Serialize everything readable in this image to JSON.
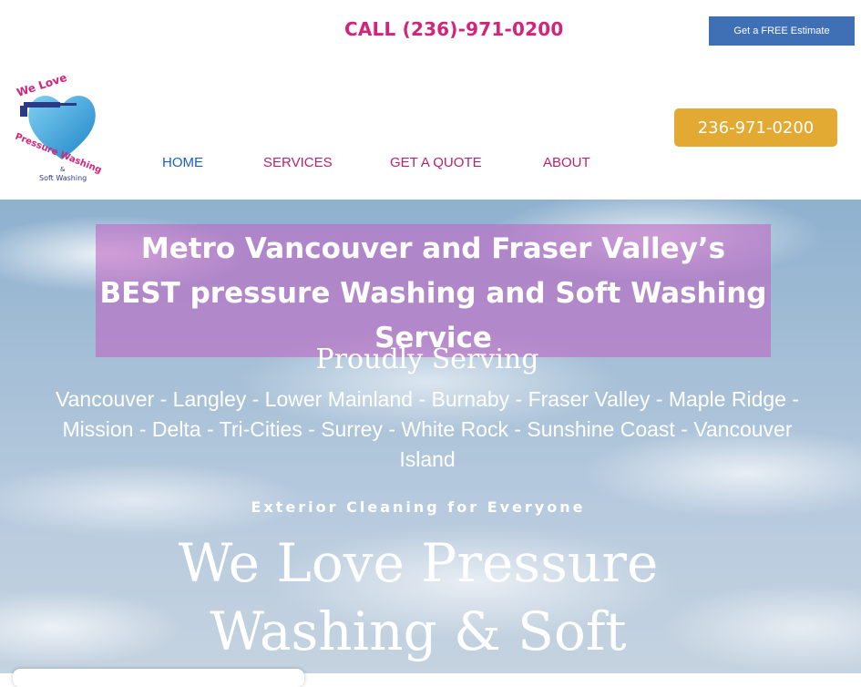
{
  "header": {
    "call_text": "CALL (236)-971-0200",
    "estimate_button": "Get a FREE Estimate",
    "phone_button": "236-971-0200"
  },
  "logo": {
    "line1": "We Love",
    "line2": "Pressure Washing",
    "line3": "&",
    "line4": "Soft Washing"
  },
  "nav": {
    "items": [
      {
        "label": "HOME",
        "active": true
      },
      {
        "label": "SERVICES",
        "active": false
      },
      {
        "label": "GET A QUOTE",
        "active": false
      },
      {
        "label": "ABOUT",
        "active": false
      }
    ]
  },
  "hero": {
    "headline_line1": "Metro Vancouver and Fraser Valley’s",
    "headline_line2": "BEST pressure Washing and Soft Washing",
    "headline_line3": "Service",
    "serving_title": "Proudly Serving",
    "serving_list": "Vancouver - Langley - Lower Mainland - Burnaby - Fraser Valley - Maple Ridge - Mission - Delta - Tri-Cities - Surrey - White Rock - Sunshine Coast - Vancouver Island",
    "tagline": "Exterior Cleaning for Everyone",
    "big_title_line1": "We Love Pressure",
    "big_title_line2": "Washing & Soft"
  },
  "colors": {
    "pink": "#d4237a",
    "nav_pink": "#b8226f",
    "nav_active": "#1d5fc4",
    "estimate_blue": "#3f6fb5",
    "phone_gold": "#e2aa33",
    "headline_overlay": "#bd69c4"
  }
}
